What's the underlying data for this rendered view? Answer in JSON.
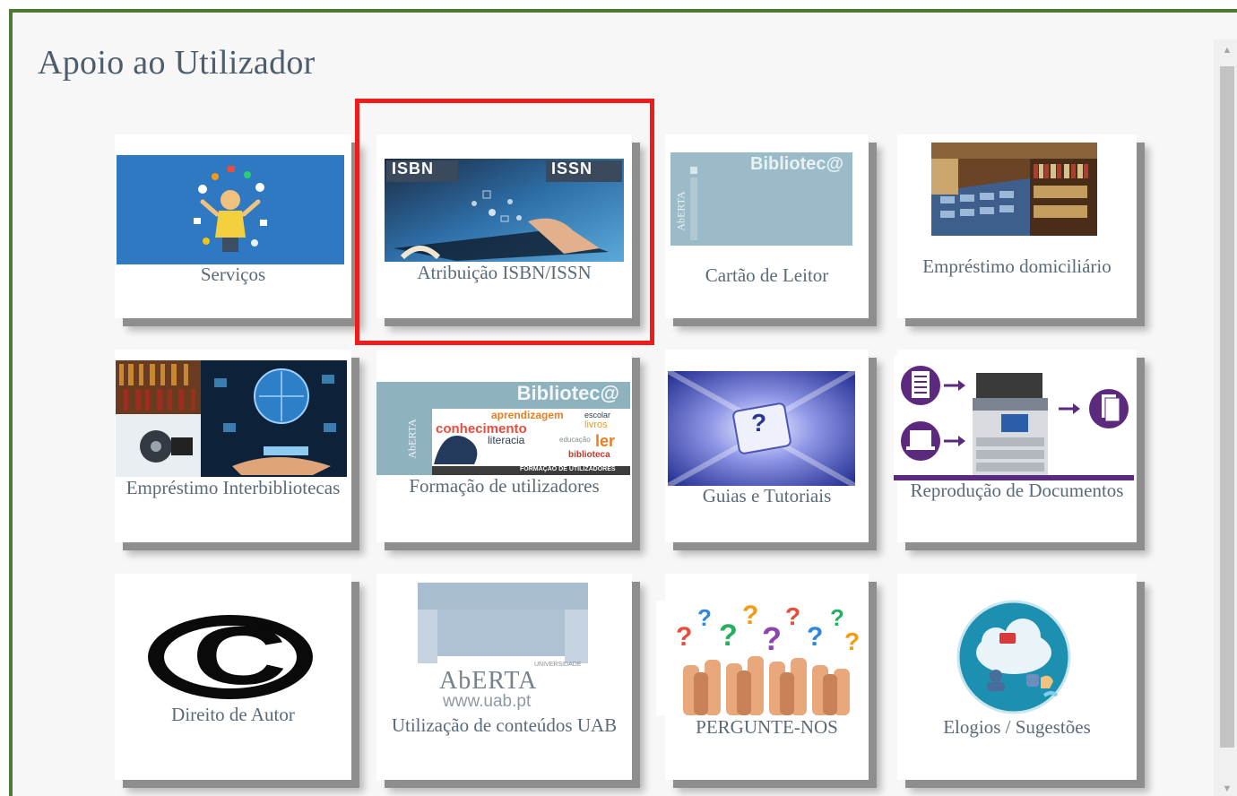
{
  "page": {
    "title": "Apoio ao Utilizador"
  },
  "tiles": [
    {
      "label": "Serviços",
      "image": "servicos-illustration"
    },
    {
      "label": "Atribuição ISBN/ISSN",
      "image": "isbn-issn-tablet",
      "badge_left": "ISBN",
      "badge_right": "ISSN"
    },
    {
      "label": "Cartão de Leitor",
      "image": "biblioteca-card",
      "brand": "Bibliotec@",
      "side_text": "AbERTA"
    },
    {
      "label": "Empréstimo domiciliário",
      "image": "library-shelves"
    },
    {
      "label": "Empréstimo Interbibliotecas",
      "image": "interlibrary-globe"
    },
    {
      "label": "Formação de utilizadores",
      "image": "formacao-wordcloud",
      "brand": "Bibliotec@",
      "side_text": "AbERTA",
      "words": [
        "aprendizagem",
        "escolar",
        "livros",
        "conhecimento",
        "literacia",
        "educação",
        "ler",
        "biblioteca"
      ],
      "footer": "FORMAÇÃO DE UTILIZADORES"
    },
    {
      "label": "Guias e Tutoriais",
      "image": "question-key",
      "key_glyph": "?"
    },
    {
      "label": "Reprodução de Documentos",
      "image": "copier-documents"
    },
    {
      "label": "Direito de Autor",
      "image": "copyright-symbol",
      "symbol": "C"
    },
    {
      "label": "Utilização de conteúdos UAB",
      "image": "uab-logo",
      "logo_small": "UNIVERSIDADE",
      "logo_name": "AbERTA",
      "logo_url": "www.uab.pt"
    },
    {
      "label": "PERGUNTE-NOS",
      "image": "question-hands",
      "glyph": "?"
    },
    {
      "label": "Elogios / Sugestões",
      "image": "feedback-cloud"
    }
  ],
  "colors": {
    "frame_border": "#4f7a31",
    "highlight": "#ef1c1c",
    "label_text": "#5a6a78"
  }
}
